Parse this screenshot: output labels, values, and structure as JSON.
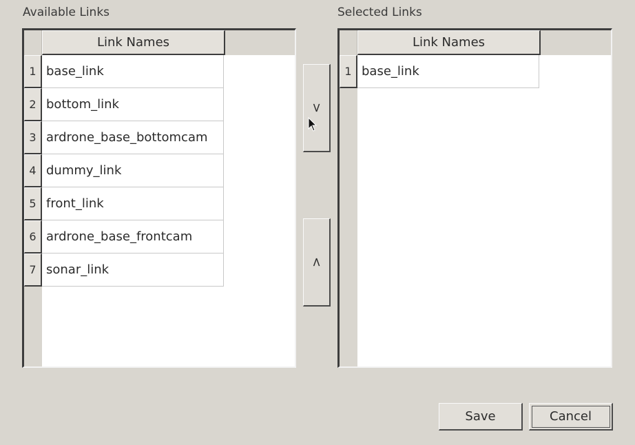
{
  "available": {
    "label": "Available Links",
    "column_header": "Link Names",
    "rows": [
      {
        "num": "1",
        "name": "base_link"
      },
      {
        "num": "2",
        "name": "bottom_link"
      },
      {
        "num": "3",
        "name": "ardrone_base_bottomcam"
      },
      {
        "num": "4",
        "name": "dummy_link"
      },
      {
        "num": "5",
        "name": "front_link"
      },
      {
        "num": "6",
        "name": "ardrone_base_frontcam"
      },
      {
        "num": "7",
        "name": "sonar_link"
      }
    ]
  },
  "selected": {
    "label": "Selected Links",
    "column_header": "Link Names",
    "rows": [
      {
        "num": "1",
        "name": "base_link"
      }
    ]
  },
  "buttons": {
    "add": ">",
    "remove": "<",
    "save": "Save",
    "cancel": "Cancel"
  },
  "colors": {
    "background": "#d9d6cf",
    "table_bg": "#ffffff",
    "border_dark": "#3d3d3d"
  }
}
